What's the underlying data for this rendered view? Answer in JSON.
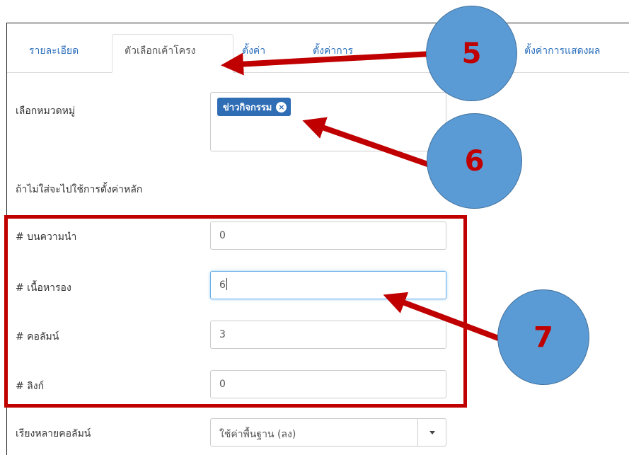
{
  "tabs": {
    "details": "รายละเอียด",
    "layout_options": "ตัวเลือกเค้าโครง",
    "settings": "ตั้งค่า",
    "hidden_tab": "ตั้งค่าการ",
    "display_settings": "ตั้งค่าการแสดงผล"
  },
  "category": {
    "label": "เลือกหมวดหมู่",
    "chip": "ข่าวกิจกรรม",
    "remove_glyph": "×",
    "hint": "ถ้าไม่ใส่จะไปใช้การตั้งค่าหลัก"
  },
  "fields": {
    "leading": {
      "label": "# บนความนำ",
      "value": "0"
    },
    "intro": {
      "label": "# เนื้อหารอง",
      "value": "6"
    },
    "columns": {
      "label": "# คอลัมน์",
      "value": "3"
    },
    "links": {
      "label": "# ลิงก์",
      "value": "0"
    }
  },
  "multi_column": {
    "label": "เรียงหลายคอลัมน์",
    "value": "ใช้ค่าพื้นฐาน (ลง)"
  },
  "callouts": {
    "c5": "5",
    "c6": "6",
    "c7": "7"
  },
  "colors": {
    "annotation_red": "#c00000",
    "circle_blue": "#5b9bd5",
    "chip_blue": "#2f6db5",
    "link_blue": "#2a6ebb"
  }
}
